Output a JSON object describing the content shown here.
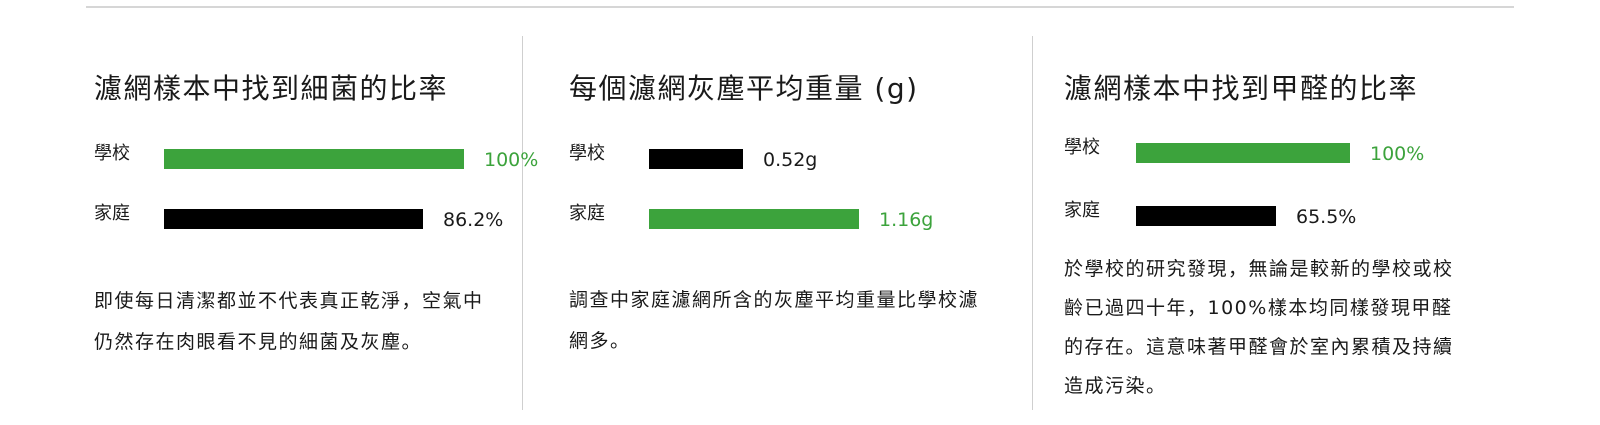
{
  "colors": {
    "highlight": "#3ca33c",
    "default": "#000000"
  },
  "chart_data": [
    {
      "type": "bar",
      "title": "濾網樣本中找到細菌的比率",
      "categories": [
        "學校",
        "家庭"
      ],
      "values": [
        100,
        86.2
      ],
      "value_labels": [
        "100%",
        "86.2%"
      ],
      "highlight": [
        true,
        false
      ],
      "xlim": [
        0,
        100
      ]
    },
    {
      "type": "bar",
      "title": "每個濾網灰塵平均重量 (g)",
      "categories": [
        "學校",
        "家庭"
      ],
      "values": [
        0.52,
        1.16
      ],
      "value_labels": [
        "0.52g",
        "1.16g"
      ],
      "highlight": [
        false,
        true
      ],
      "xlim": [
        0,
        1.16
      ]
    },
    {
      "type": "bar",
      "title": "濾網樣本中找到甲醛的比率",
      "categories": [
        "學校",
        "家庭"
      ],
      "values": [
        100,
        65.5
      ],
      "value_labels": [
        "100%",
        "65.5%"
      ],
      "highlight": [
        true,
        false
      ],
      "xlim": [
        0,
        100
      ]
    }
  ],
  "descriptions": [
    "即使每日清潔都並不代表真正乾淨，空氣中仍然存在肉眼看不見的細菌及灰塵。",
    "調查中家庭濾網所含的灰塵平均重量比學校濾網多。",
    "於學校的研究發現，無論是較新的學校或校齡已過四十年，100%樣本均同樣發現甲醛的存在。這意味著甲醛會於室內累積及持續造成污染。"
  ]
}
